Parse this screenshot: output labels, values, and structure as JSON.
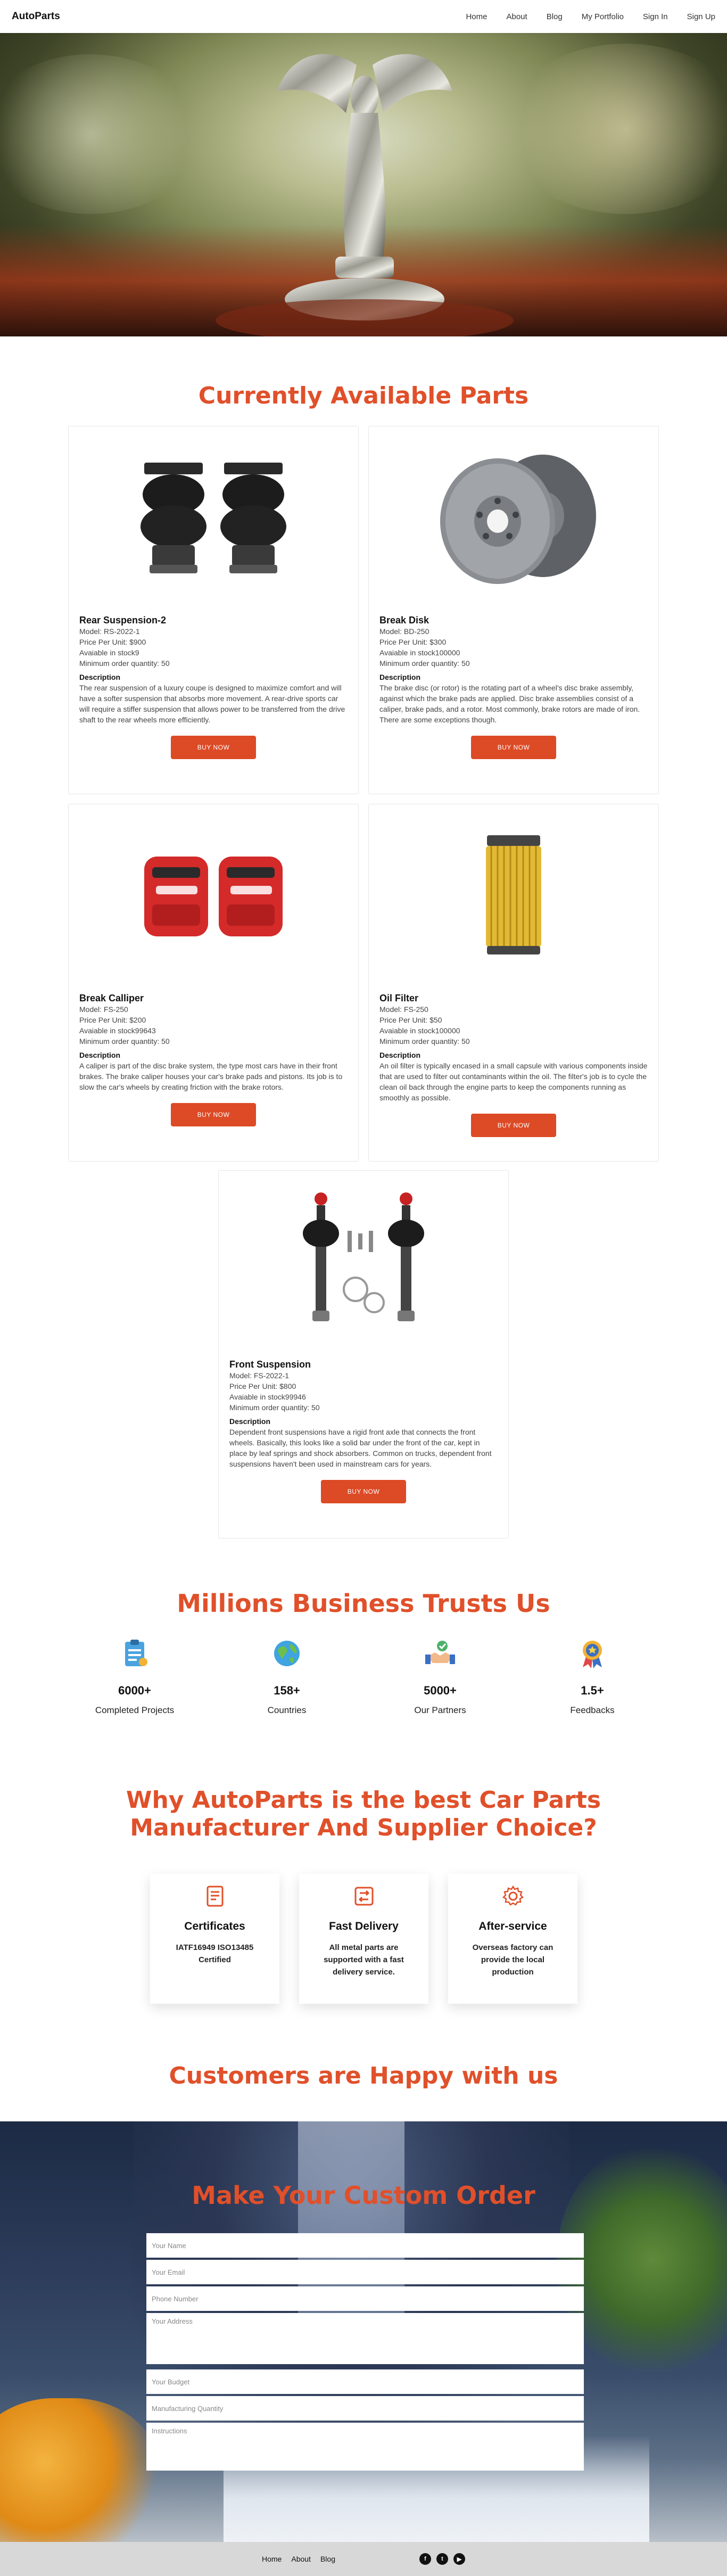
{
  "nav": {
    "brand": "AutoParts",
    "links": [
      "Home",
      "About",
      "Blog",
      "My Portfolio",
      "Sign In",
      "Sign Up"
    ]
  },
  "parts_section": {
    "title": "Currently Available Parts"
  },
  "parts": [
    {
      "name": "Rear Suspension-2",
      "model": "Model: RS-2022-1",
      "price": "Price Per Unit: $900",
      "stock": "Avaiable in stock9",
      "min_order": "Minimum order quantity: 50",
      "desc_label": "Description",
      "desc": "The rear suspension of a luxury coupe is designed to maximize comfort and will have a softer suspension that absorbs more movement. A rear-drive sports car will require a stiffer suspension that allows power to be transferred from the drive shaft to the rear wheels more efficiently.",
      "button": "BUY NOW",
      "image_icon": "air-spring-icon"
    },
    {
      "name": "Break Disk",
      "model": "Model: BD-250",
      "price": "Price Per Unit: $300",
      "stock": "Avaiable in stock100000",
      "min_order": "Minimum order quantity: 50",
      "desc_label": "Description",
      "desc": "The brake disc (or rotor) is the rotating part of a wheel's disc brake assembly, against which the brake pads are applied. Disc brake assemblies consist of a caliper, brake pads, and a rotor. Most commonly, brake rotors are made of iron. There are some exceptions though.",
      "button": "BUY NOW",
      "image_icon": "brake-disc-icon"
    },
    {
      "name": "Break Calliper",
      "model": "Model: FS-250",
      "price": "Price Per Unit: $200",
      "stock": "Avaiable in stock99643",
      "min_order": "Minimum order quantity: 50",
      "desc_label": "Description",
      "desc": "A caliper is part of the disc brake system, the type most cars have in their front brakes. The brake caliper houses your car's brake pads and pistons. Its job is to slow the car's wheels by creating friction with the brake rotors.",
      "button": "BUY NOW",
      "image_icon": "brake-caliper-icon"
    },
    {
      "name": "Oil Filter",
      "model": "Model: FS-250",
      "price": "Price Per Unit: $50",
      "stock": "Avaiable in stock100000",
      "min_order": "Minimum order quantity: 50",
      "desc_label": "Description",
      "desc": "An oil filter is typically encased in a small capsule with various components inside that are used to filter out contaminants within the oil. The filter's job is to cycle the clean oil back through the engine parts to keep the components running as smoothly as possible.",
      "button": "BUY NOW",
      "image_icon": "oil-filter-icon"
    },
    {
      "name": "Front Suspension",
      "model": "Model: FS-2022-1",
      "price": "Price Per Unit: $800",
      "stock": "Avaiable in stock99946",
      "min_order": "Minimum order quantity: 50",
      "desc_label": "Description",
      "desc": "Dependent front suspensions have a rigid front axle that connects the front wheels. Basically, this looks like a solid bar under the front of the car, kept in place by leaf springs and shock absorbers. Common on trucks, dependent front suspensions haven't been used in mainstream cars for years.",
      "button": "BUY NOW",
      "image_icon": "coilover-icon"
    }
  ],
  "trust": {
    "title": "Millions Business Trusts Us",
    "stats": [
      {
        "value": "6000+",
        "label": "Completed Projects",
        "icon": "clipboard-icon"
      },
      {
        "value": "158+",
        "label": "Countries",
        "icon": "globe-icon"
      },
      {
        "value": "5000+",
        "label": "Our Partners",
        "icon": "handshake-icon"
      },
      {
        "value": "1.5+",
        "label": "Feedbacks",
        "icon": "award-medal-icon"
      }
    ]
  },
  "why": {
    "title_line1": "Why AutoParts is the best Car Parts",
    "title_line2": "Manufacturer And Supplier Choice?",
    "features": [
      {
        "title": "Certificates",
        "desc": "IATF16949 ISO13485 Certified",
        "icon": "certificate-icon"
      },
      {
        "title": "Fast Delivery",
        "desc": "All metal parts are supported with a fast delivery service.",
        "icon": "delivery-icon"
      },
      {
        "title": "After-service",
        "desc": "Overseas factory can provide the local production",
        "icon": "gear-icon"
      }
    ]
  },
  "customers": {
    "title": "Customers are Happy with us"
  },
  "order": {
    "title": "Make Your Custom Order",
    "placeholders": {
      "name": "Your Name",
      "email": "Your Email",
      "phone": "Phone Number",
      "address": "Your Address",
      "budget": "Your Budget",
      "quantity": "Manufacturing Quantity",
      "instructions": "Instructions"
    }
  },
  "footer": {
    "links": [
      "Home",
      "About",
      "Blog"
    ],
    "socials": [
      "facebook-icon",
      "twitter-icon",
      "youtube-icon"
    ]
  },
  "colors": {
    "accent": "#e0502a",
    "button": "#dc4a26",
    "footer_bg": "#d8d8d8"
  }
}
